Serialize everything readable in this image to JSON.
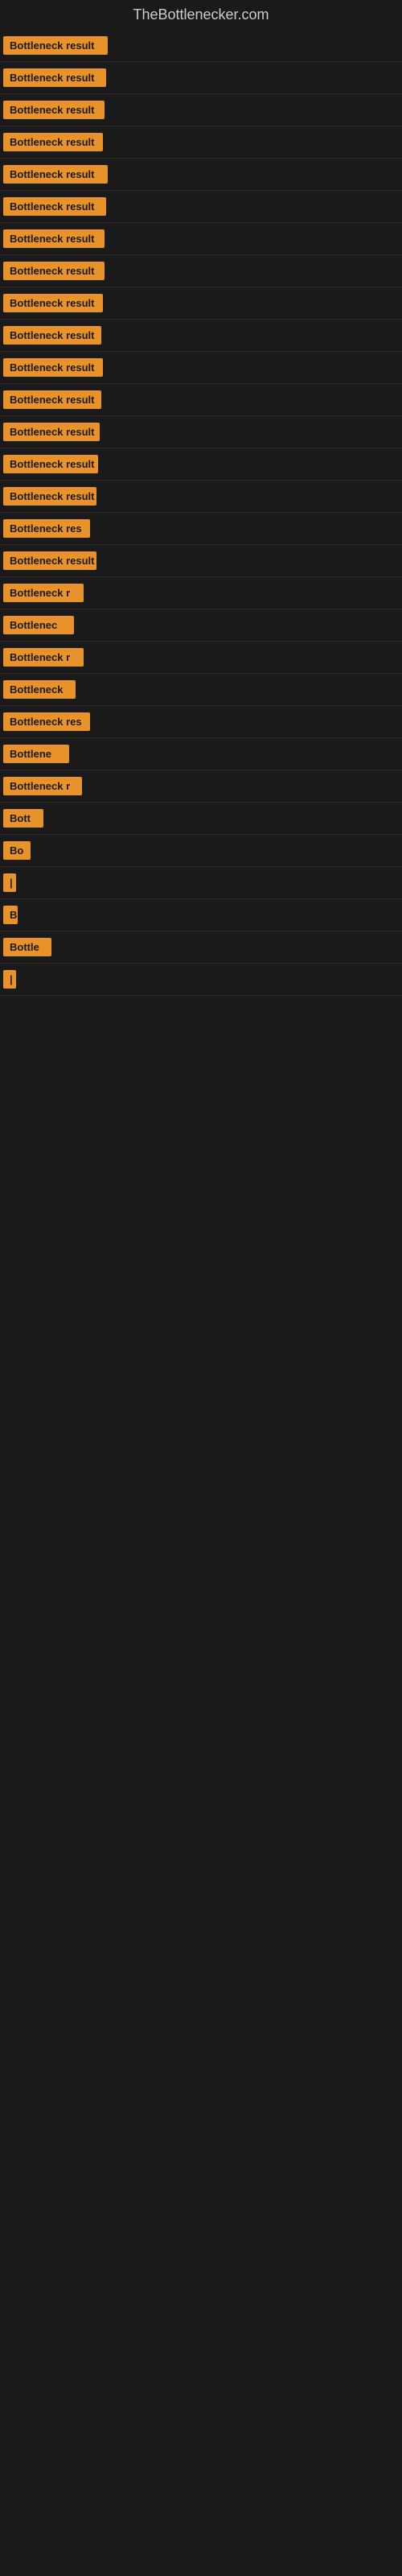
{
  "site": {
    "title": "TheBottlenecker.com"
  },
  "items": [
    {
      "label": "Bottleneck result",
      "width": 130
    },
    {
      "label": "Bottleneck result",
      "width": 128
    },
    {
      "label": "Bottleneck result",
      "width": 126
    },
    {
      "label": "Bottleneck result",
      "width": 124
    },
    {
      "label": "Bottleneck result",
      "width": 130
    },
    {
      "label": "Bottleneck result",
      "width": 128
    },
    {
      "label": "Bottleneck result",
      "width": 126
    },
    {
      "label": "Bottleneck result",
      "width": 126
    },
    {
      "label": "Bottleneck result",
      "width": 124
    },
    {
      "label": "Bottleneck result",
      "width": 122
    },
    {
      "label": "Bottleneck result",
      "width": 124
    },
    {
      "label": "Bottleneck result",
      "width": 122
    },
    {
      "label": "Bottleneck result",
      "width": 120
    },
    {
      "label": "Bottleneck result",
      "width": 118
    },
    {
      "label": "Bottleneck result",
      "width": 116
    },
    {
      "label": "Bottleneck res",
      "width": 108
    },
    {
      "label": "Bottleneck result",
      "width": 116
    },
    {
      "label": "Bottleneck r",
      "width": 100
    },
    {
      "label": "Bottlenec",
      "width": 88
    },
    {
      "label": "Bottleneck r",
      "width": 100
    },
    {
      "label": "Bottleneck",
      "width": 90
    },
    {
      "label": "Bottleneck res",
      "width": 108
    },
    {
      "label": "Bottlene",
      "width": 82
    },
    {
      "label": "Bottleneck r",
      "width": 98
    },
    {
      "label": "Bott",
      "width": 50
    },
    {
      "label": "Bo",
      "width": 34
    },
    {
      "label": "|",
      "width": 10
    },
    {
      "label": "B",
      "width": 18
    },
    {
      "label": "Bottle",
      "width": 60
    },
    {
      "label": "|",
      "width": 10
    }
  ]
}
